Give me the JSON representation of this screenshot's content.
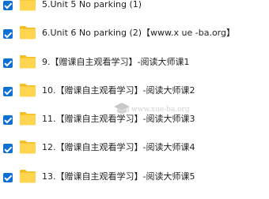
{
  "files": [
    {
      "name": "5.Unit 5 No parking (1)",
      "checked": true,
      "icon": "folder-icon"
    },
    {
      "name": "6.Unit 6 No parking (2)【www.x ue -ba.org】",
      "checked": true,
      "icon": "folder-icon"
    },
    {
      "name": "9.【赠课自主观看学习】-阅读大师课1",
      "checked": true,
      "icon": "folder-icon"
    },
    {
      "name": "10.【赠课自主观看学习】-阅读大师课2",
      "checked": true,
      "icon": "folder-icon"
    },
    {
      "name": "11.【赠课自主观看学习】-阅读大师课3",
      "checked": true,
      "icon": "folder-icon"
    },
    {
      "name": "12.【赠课自主观看学习】-阅读大师课4",
      "checked": true,
      "icon": "folder-icon"
    },
    {
      "name": "13.【赠课自主观看学习】-阅读大师课5",
      "checked": true,
      "icon": "folder-icon"
    }
  ],
  "watermark": {
    "text": "www.xue-ba.org",
    "icon": "graduation-cap-icon"
  },
  "colors": {
    "checkbox": "#0e70d3",
    "folder_back": "#f5bd1f",
    "folder_front": "#ffd54f",
    "text": "#1f1f1f"
  }
}
